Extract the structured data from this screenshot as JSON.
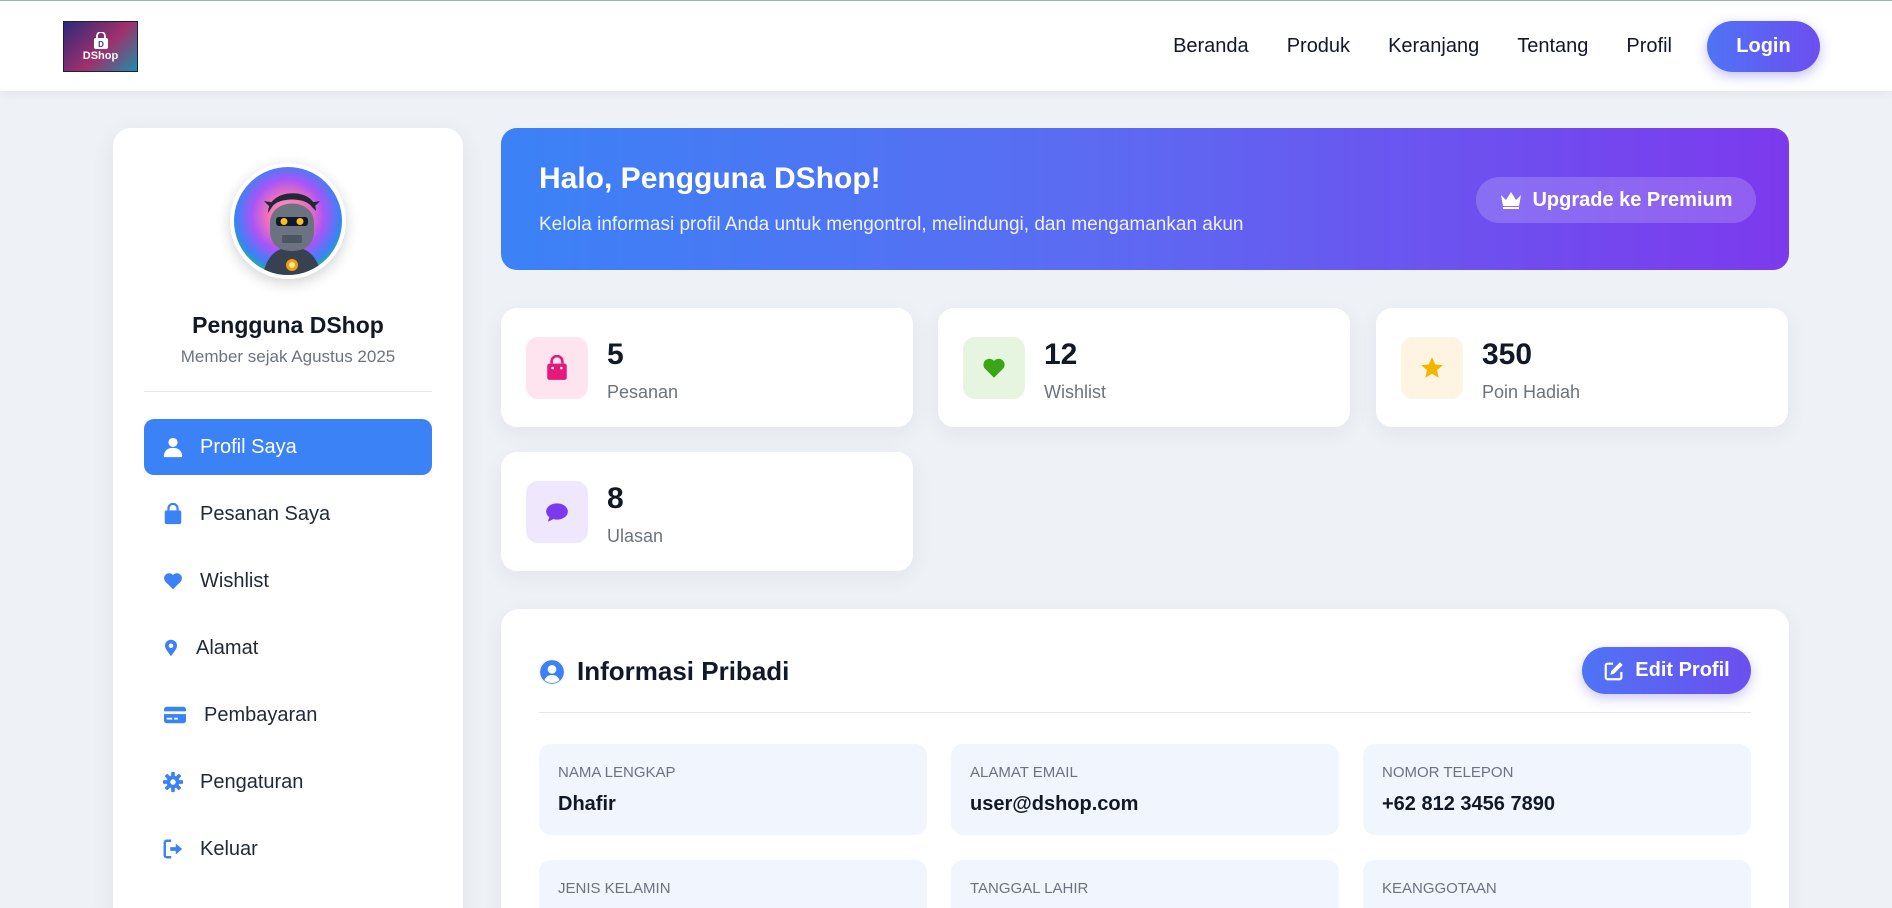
{
  "header": {
    "logo_text": "DShop",
    "nav": [
      "Beranda",
      "Produk",
      "Keranjang",
      "Tentang",
      "Profil"
    ],
    "login_label": "Login"
  },
  "sidebar": {
    "avatar_icon": "robot-avatar",
    "user_name": "Pengguna DShop",
    "member_since": "Member sejak Agustus 2025",
    "items": [
      {
        "label": "Profil Saya",
        "icon": "user-icon",
        "active": true
      },
      {
        "label": "Pesanan Saya",
        "icon": "shopping-bag-icon",
        "active": false
      },
      {
        "label": "Wishlist",
        "icon": "heart-icon",
        "active": false
      },
      {
        "label": "Alamat",
        "icon": "map-pin-icon",
        "active": false
      },
      {
        "label": "Pembayaran",
        "icon": "credit-card-icon",
        "active": false
      },
      {
        "label": "Pengaturan",
        "icon": "gear-icon",
        "active": false
      },
      {
        "label": "Keluar",
        "icon": "logout-icon",
        "active": false
      }
    ]
  },
  "banner": {
    "title": "Halo, Pengguna DShop!",
    "subtitle": "Kelola informasi profil Anda untuk mengontrol, melindungi, dan mengamankan akun",
    "premium_label": "Upgrade ke Premium"
  },
  "stats": [
    {
      "value": "5",
      "label": "Pesanan",
      "icon": "shopping-bag-icon",
      "color": "#e6197a",
      "bg": "#fde4ef"
    },
    {
      "value": "12",
      "label": "Wishlist",
      "icon": "heart-icon",
      "color": "#3aa517",
      "bg": "#e6f5df"
    },
    {
      "value": "350",
      "label": "Poin Hadiah",
      "icon": "star-icon",
      "color": "#f4b400",
      "bg": "#fdf5e2"
    },
    {
      "value": "8",
      "label": "Ulasan",
      "icon": "comment-icon",
      "color": "#7c3aed",
      "bg": "#efe8fc"
    }
  ],
  "info": {
    "title": "Informasi Pribadi",
    "edit_label": "Edit Profil",
    "fields": [
      {
        "label": "Nama Lengkap",
        "value": "Dhafir"
      },
      {
        "label": "Alamat Email",
        "value": "user@dshop.com"
      },
      {
        "label": "Nomor Telepon",
        "value": "+62 812 3456 7890"
      },
      {
        "label": "Jenis Kelamin",
        "value": ""
      },
      {
        "label": "Tanggal Lahir",
        "value": ""
      },
      {
        "label": "Keanggotaan",
        "value": ""
      }
    ]
  },
  "colors": {
    "primary": "#3b82f6",
    "accent": "#7c3aed"
  }
}
